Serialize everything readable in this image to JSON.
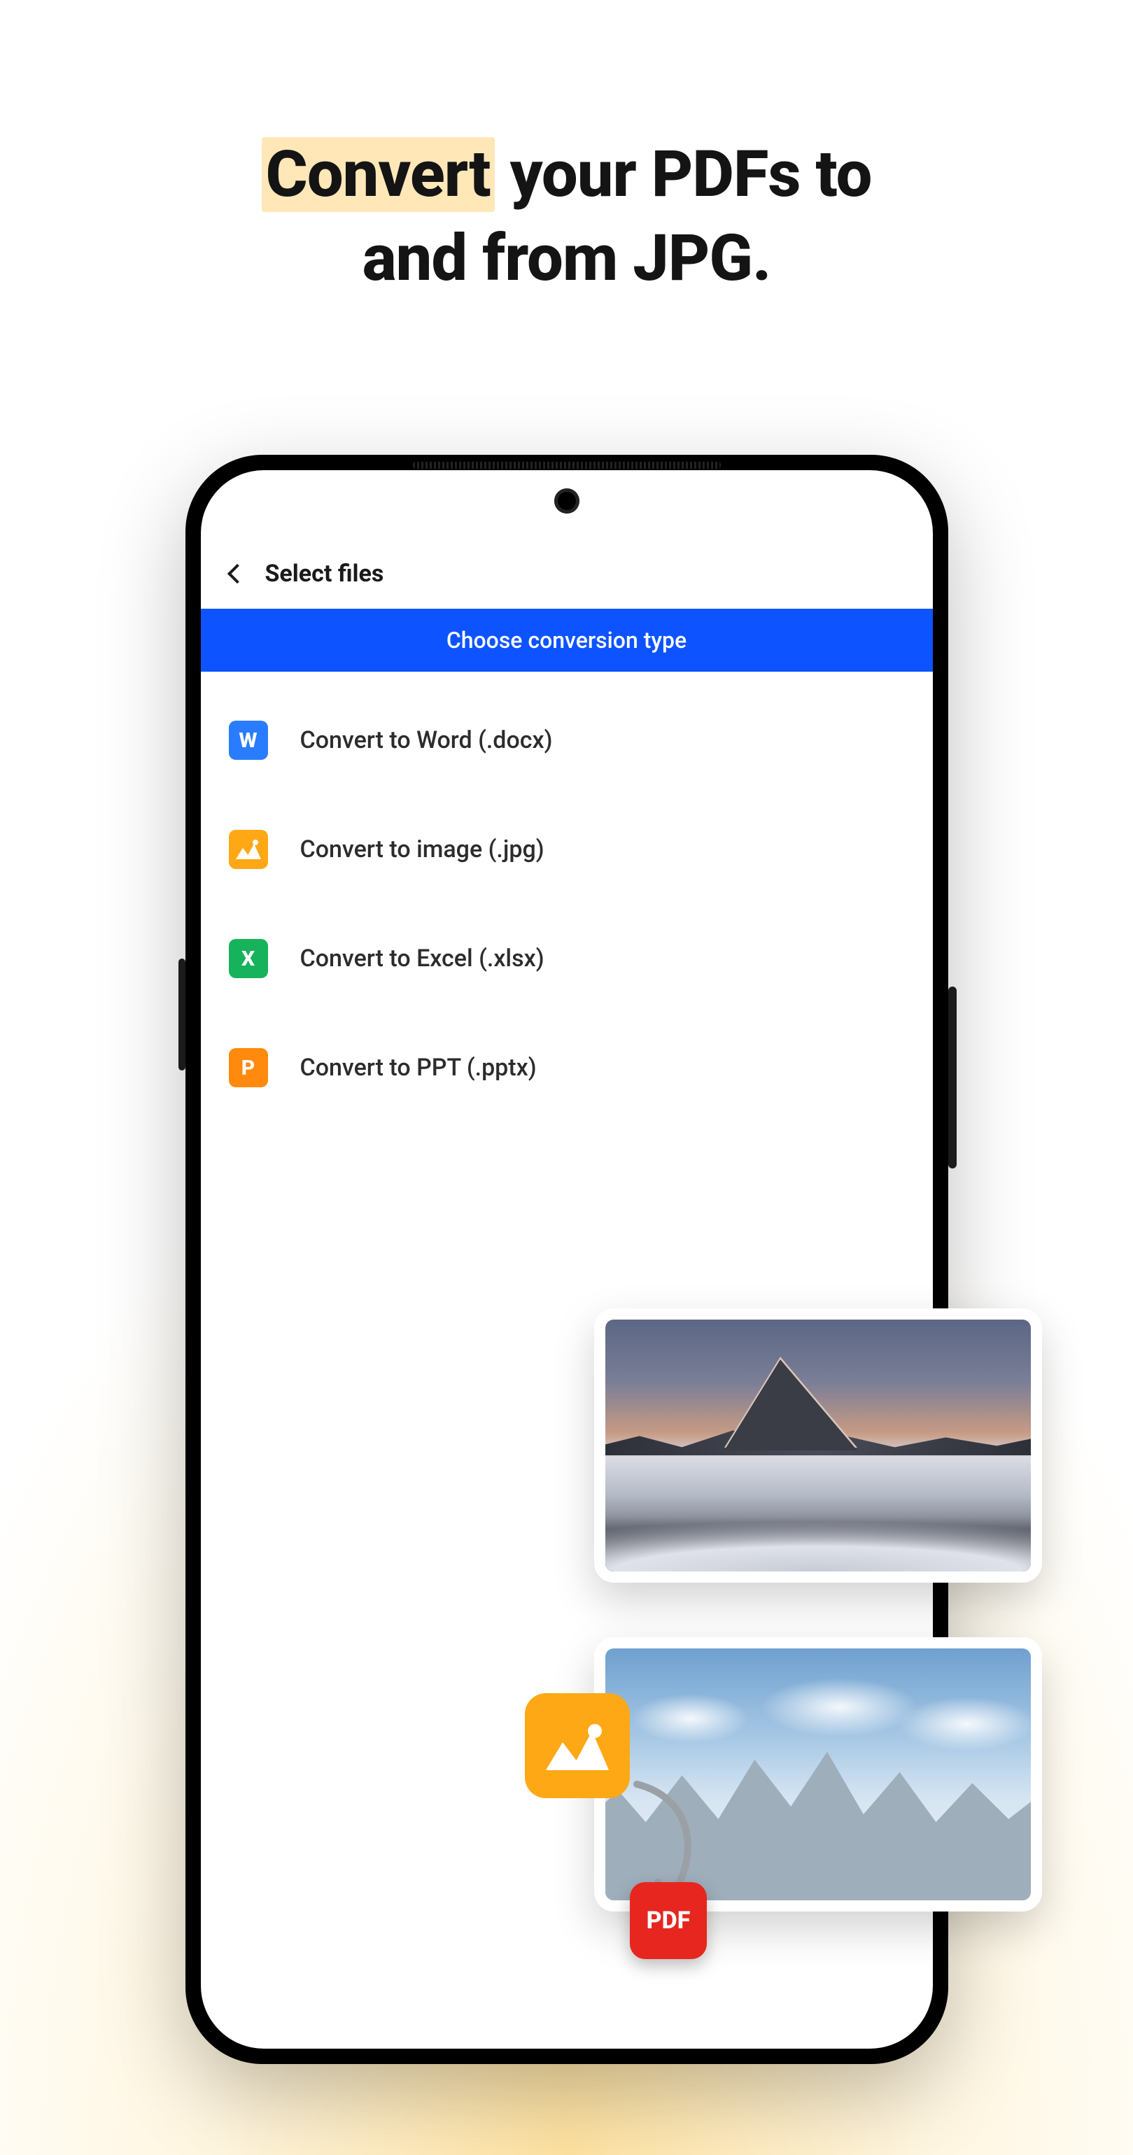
{
  "headline": {
    "highlight": "Convert",
    "rest_line1": " your PDFs to",
    "line2": "and from JPG."
  },
  "header": {
    "title": "Select files"
  },
  "banner": {
    "text": "Choose conversion type"
  },
  "options": [
    {
      "icon": "word",
      "glyph": "W",
      "label": "Convert to Word (.docx)"
    },
    {
      "icon": "image",
      "glyph": "",
      "label": "Convert to image (.jpg)"
    },
    {
      "icon": "excel",
      "glyph": "X",
      "label": "Convert to Excel (.xlsx)"
    },
    {
      "icon": "ppt",
      "glyph": "P",
      "label": "Convert to PPT (.pptx)"
    }
  ],
  "pdf_badge": {
    "label": "PDF"
  }
}
